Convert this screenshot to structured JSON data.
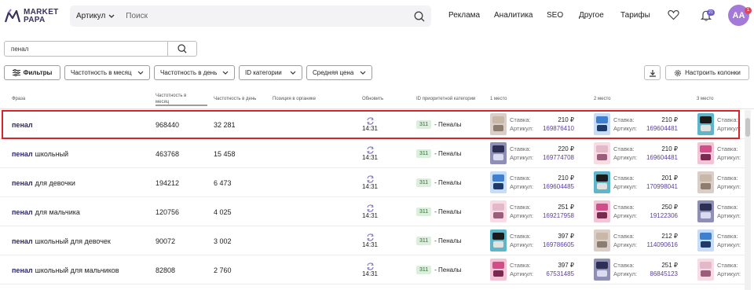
{
  "brand": {
    "line1": "MARKET",
    "line2": "PAPA"
  },
  "search": {
    "type_label": "Артикул",
    "placeholder": "Поиск"
  },
  "nav": [
    "Реклама",
    "Аналитика",
    "SEO",
    "Другое",
    "Тарифы"
  ],
  "notifications": {
    "count": "21"
  },
  "user": {
    "initials": "AA",
    "badge": "1"
  },
  "query": {
    "value": "пенал"
  },
  "filters": {
    "main": "Фильтры",
    "dropdowns": [
      "Частотность в месяц",
      "Частотность в день",
      "ID категории",
      "Средняя цена"
    ],
    "columns_button": "Настроить колонки"
  },
  "table": {
    "headers": {
      "phrase": "Фраза",
      "freq_month": "Частотность в месяц",
      "freq_day": "Частотность в день",
      "position": "Позиция в органике",
      "refresh": "Обновить",
      "category": "ID приоритетной категории",
      "place1": "1 место",
      "place2": "2 место",
      "place3": "3 место"
    },
    "slot_labels": {
      "bid": "Ставка:",
      "article": "Артикул:"
    },
    "rows": [
      {
        "key": "пенал",
        "rest": "",
        "freq_month": "968440",
        "freq_day": "32 281",
        "time": "14:31",
        "cat_id": "311",
        "cat_name": "- Пеналы",
        "p1": {
          "bid": "210 ₽",
          "article": "169876410"
        },
        "p2": {
          "bid": "210 ₽",
          "article": "169604481"
        }
      },
      {
        "key": "пенал",
        "rest": "школьный",
        "freq_month": "463768",
        "freq_day": "15 458",
        "time": "14:31",
        "cat_id": "311",
        "cat_name": "- Пеналы",
        "p1": {
          "bid": "220 ₽",
          "article": "169774708"
        },
        "p2": {
          "bid": "210 ₽",
          "article": "169604481"
        }
      },
      {
        "key": "пенал",
        "rest": "для девочки",
        "freq_month": "194212",
        "freq_day": "6 473",
        "time": "14:31",
        "cat_id": "311",
        "cat_name": "- Пеналы",
        "p1": {
          "bid": "210 ₽",
          "article": "169604485"
        },
        "p2": {
          "bid": "201 ₽",
          "article": "170998041"
        }
      },
      {
        "key": "пенал",
        "rest": "для мальчика",
        "freq_month": "120756",
        "freq_day": "4 025",
        "time": "14:31",
        "cat_id": "311",
        "cat_name": "- Пеналы",
        "p1": {
          "bid": "251 ₽",
          "article": "169217958"
        },
        "p2": {
          "bid": "250 ₽",
          "article": "19122306"
        }
      },
      {
        "key": "пенал",
        "rest": "школьный для девочек",
        "freq_month": "90072",
        "freq_day": "3 002",
        "time": "14:31",
        "cat_id": "311",
        "cat_name": "- Пеналы",
        "p1": {
          "bid": "397 ₽",
          "article": "169786605"
        },
        "p2": {
          "bid": "212 ₽",
          "article": "114090616"
        }
      },
      {
        "key": "пенал",
        "rest": "школьный для мальчиков",
        "freq_month": "82808",
        "freq_day": "2 760",
        "time": "14:31",
        "cat_id": "311",
        "cat_name": "- Пеналы",
        "p1": {
          "bid": "397 ₽",
          "article": "67531485"
        },
        "p2": {
          "bid": "251 ₽",
          "article": "86845123"
        }
      }
    ]
  },
  "colors": {
    "accent": "#5a3fa0",
    "highlight": "#d8232a",
    "phrase": "#2e2a6b",
    "category_bg": "#dcefdc"
  }
}
